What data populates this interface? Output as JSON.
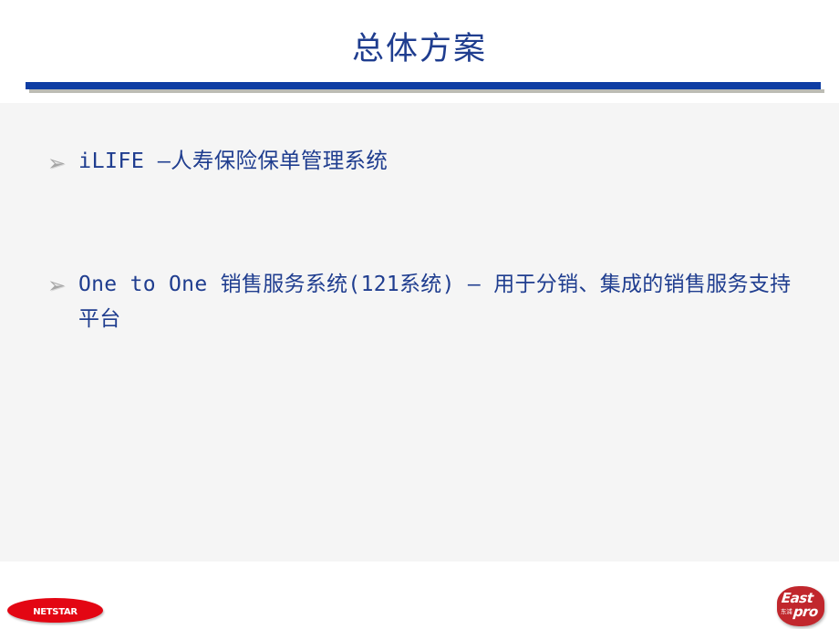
{
  "slide": {
    "title": "总体方案",
    "bullets": [
      {
        "marker": "➢",
        "text": "iLIFE –人寿保险保单管理系统"
      },
      {
        "marker": "➢",
        "text": "One to One 销售服务系统(121系统) – 用于分销、集成的销售服务支持平台"
      }
    ]
  },
  "footer": {
    "left_logo": {
      "name": "NETSTAR",
      "text": "NetStar",
      "color": "#E30613"
    },
    "right_logo": {
      "name": "EastPro",
      "line1": "East",
      "line2": "pro",
      "chinese": "东浦",
      "color": "#C1272D"
    }
  },
  "colors": {
    "title_text": "#1F3D8F",
    "rule": "#0E3DA3",
    "rule_shadow": "#bcbcb4",
    "body_text": "#1F3D8F",
    "panel_bg": "#f5f5f5",
    "marker": "#a6a6a6"
  }
}
